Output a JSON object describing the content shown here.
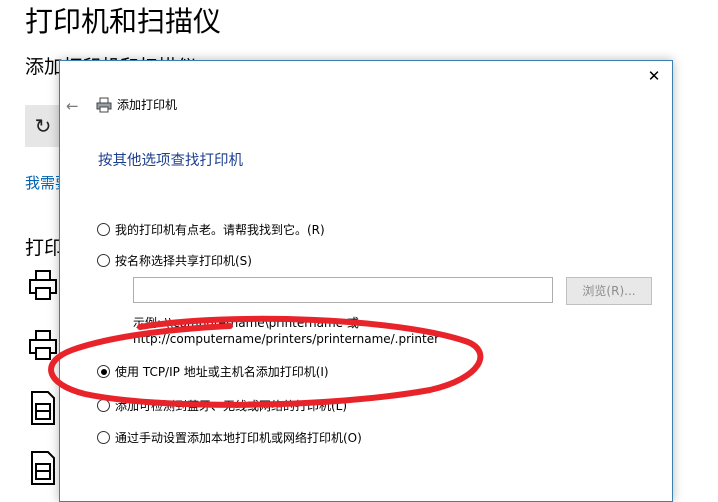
{
  "background": {
    "page_title": "打印机和扫描仪",
    "section_title": "添加打印机和扫描仪",
    "refresh_icon": "refresh-icon",
    "link_text": "我需要的打印机不在列表中",
    "list_title": "打印机和扫描仪",
    "devices": [
      "printer-icon",
      "printer-icon",
      "fax-icon",
      "fax-icon"
    ]
  },
  "dialog": {
    "title": "添加打印机",
    "heading": "按其他选项查找打印机",
    "options": [
      {
        "label": "我的打印机有点老。请帮我找到它。(R)",
        "checked": false
      },
      {
        "label": "按名称选择共享打印机(S)",
        "checked": false
      },
      {
        "label": "使用 TCP/IP 地址或主机名添加打印机(I)",
        "checked": true
      },
      {
        "label": "添加可检测到蓝牙、无线或网络的打印机(L)",
        "checked": false
      },
      {
        "label": "通过手动设置添加本地打印机或网络打印机(O)",
        "checked": false
      }
    ],
    "share_input_value": "",
    "browse_label": "浏览(R)...",
    "example_line1": "示例: \\\\computername\\printername 或",
    "example_line2": "http://computername/printers/printername/.printer"
  },
  "colors": {
    "accent_blue": "#1e3f8f",
    "link_blue": "#0063b1",
    "annotation_red": "#e8242a"
  }
}
